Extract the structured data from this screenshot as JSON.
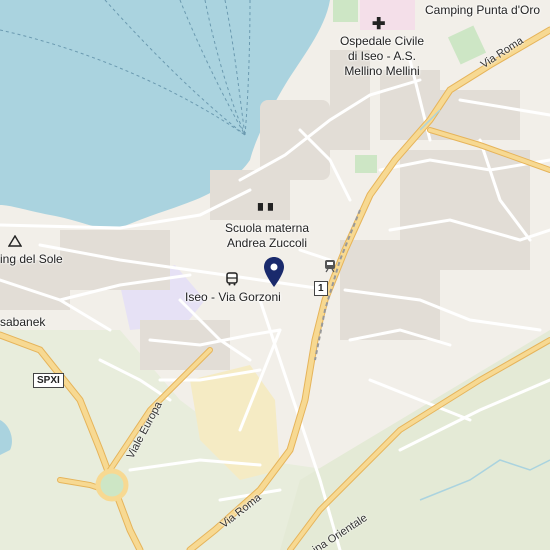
{
  "map": {
    "places": {
      "camping_punta_doro": "Camping Punta d'Oro",
      "hospital_line1": "Ospedale Civile",
      "hospital_line2": "di Iseo - A.S.",
      "hospital_line3": "Mellino Mellini",
      "school_line1": "Scuola materna",
      "school_line2": "Andrea Zuccoli",
      "bus_stop": "Iseo - Via Gorzoni",
      "camping_del_sole": "ing del Sole",
      "sabanek": "sabanek"
    },
    "roads": {
      "via_roma_ne": "Via Roma",
      "via_roma_s": "Via Roma",
      "viale_europa": "Viale Europa",
      "cintura_orientale": "ina Orientale"
    },
    "shields": {
      "spxi": "SPXI",
      "route1": "1"
    },
    "colors": {
      "water": "#aad3df",
      "land": "#f2efe9",
      "major_road": "#f7d992",
      "major_road_casing": "#e6b45a",
      "minor_road": "#ffffff",
      "park": "#e2ecd5",
      "industrial": "#f5ebc4",
      "residential_purple": "#e6e1f5",
      "marker": "#1a2a6c"
    },
    "icons": {
      "marker": "map-pin-icon",
      "hospital": "hospital-cross-icon",
      "school": "school-icon",
      "bus": "bus-icon",
      "train": "train-icon",
      "camping": "campsite-icon"
    }
  }
}
